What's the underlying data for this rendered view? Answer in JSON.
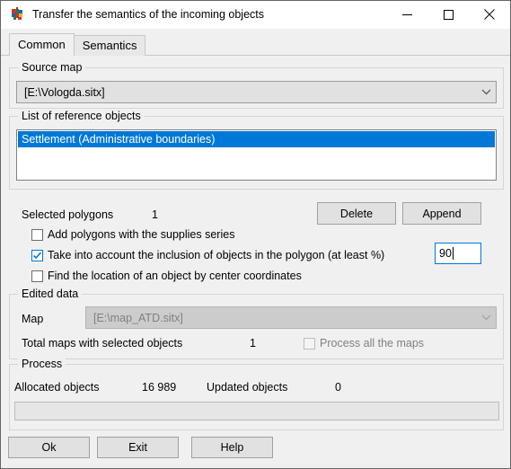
{
  "window": {
    "title": "Transfer the semantics of the incoming objects",
    "icon": "map-globe-icon",
    "minimize_label": "Minimize",
    "maximize_label": "Maximize",
    "close_label": "Close"
  },
  "tabs": [
    {
      "label": "Common",
      "active": true
    },
    {
      "label": "Semantics",
      "active": false
    }
  ],
  "source_map": {
    "group_title": "Source map",
    "combo_value": "[E:\\Vologda.sitx]"
  },
  "reference_objects": {
    "group_title": "List of reference objects",
    "items": [
      {
        "label": "Settlement (Administrative boundaries)",
        "selected": true
      }
    ]
  },
  "polygons": {
    "selected_label": "Selected polygons",
    "selected_count": "1",
    "delete_button": "Delete",
    "append_button": "Append",
    "options": [
      {
        "label": "Add polygons with the supplies series",
        "checked": false,
        "disabled": false
      },
      {
        "label": "Take into account the inclusion of objects in the polygon (at least %)",
        "checked": true,
        "disabled": false
      },
      {
        "label": "Find the location of an object by center coordinates",
        "checked": false,
        "disabled": false
      }
    ],
    "percent_value": "90"
  },
  "edited_data": {
    "group_title": "Edited data",
    "map_label": "Map",
    "map_value": "[E:\\map_ATD.sitx]",
    "total_maps_label": "Total maps with selected objects",
    "total_maps_value": "1",
    "process_all_label": "Process all the maps",
    "process_all_checked": false
  },
  "process": {
    "group_title": "Process",
    "allocated_label": "Allocated objects",
    "allocated_value": "16 989",
    "updated_label": "Updated objects",
    "updated_value": "0",
    "progress_percent": 0
  },
  "footer": {
    "ok_button": "Ok",
    "exit_button": "Exit",
    "help_button": "Help"
  },
  "colors": {
    "accent": "#0078d7",
    "window_bg": "#f0f0f0",
    "titlebar_bg": "#ffffff",
    "selection_bg": "#0078d7",
    "disabled_fg": "#808080"
  }
}
